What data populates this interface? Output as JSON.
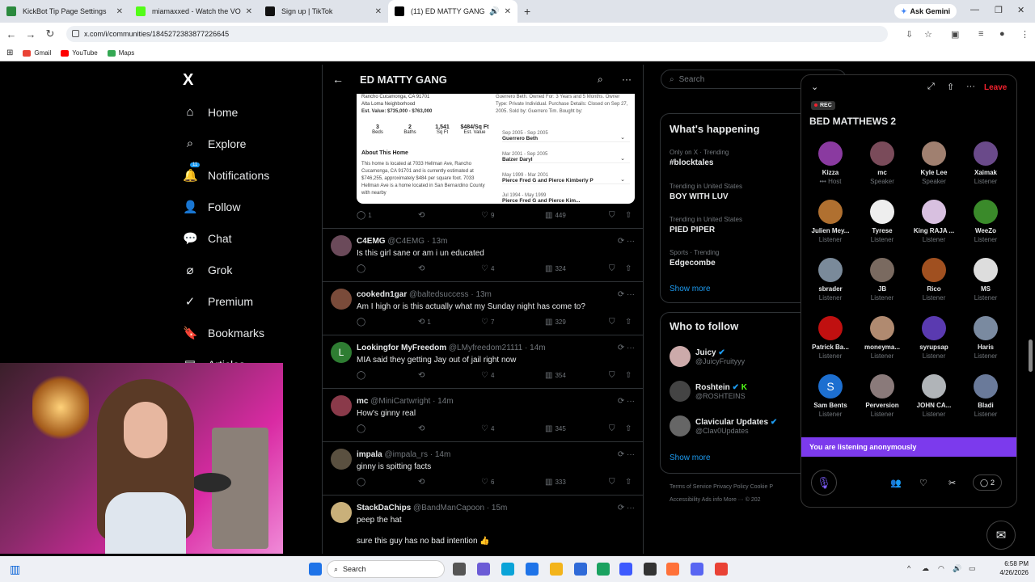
{
  "browser": {
    "tabs": [
      {
        "title": "KickBot Tip Page Settings",
        "color": "#2b8a3e"
      },
      {
        "title": "miamaxxed - Watch the VOD o",
        "color": "#53fc18"
      },
      {
        "title": "Sign up | TikTok",
        "color": "#111111"
      },
      {
        "title": "(11) ED MATTY GANG Com",
        "color": "#000000"
      }
    ],
    "new_tab": "+",
    "ask_gemini": "Ask Gemini",
    "url": "x.com/i/communities/1845272383877226645",
    "bookmarks": [
      "Gmail",
      "YouTube",
      "Maps"
    ]
  },
  "x_nav": {
    "logo": "X",
    "items": [
      {
        "label": "Home",
        "icon": "⌂"
      },
      {
        "label": "Explore",
        "icon": "⌕"
      },
      {
        "label": "Notifications",
        "icon": "🔔",
        "badge": "11"
      },
      {
        "label": "Follow",
        "icon": "👤"
      },
      {
        "label": "Chat",
        "icon": "💬"
      },
      {
        "label": "Grok",
        "icon": "⌀"
      },
      {
        "label": "Premium",
        "icon": "✓"
      },
      {
        "label": "Bookmarks",
        "icon": "🔖"
      },
      {
        "label": "Articles",
        "icon": "▤"
      }
    ]
  },
  "feed": {
    "title": "ED MATTY GANG",
    "listing": {
      "address": "Rancho Cucamonga, CA 91701",
      "neighborhood": "Alta Loma Neighborhood",
      "est_value": "Est. Value: $735,000 - $763,000",
      "stats": [
        {
          "v": "3",
          "l": "Beds"
        },
        {
          "v": "2",
          "l": "Baths"
        },
        {
          "v": "1,541",
          "l": "Sq Ft"
        },
        {
          "v": "$484/Sq Ft",
          "l": "Est. Value"
        }
      ],
      "about_title": "About This Home",
      "about_text": "This home is located at 7033 Hellman Ave, Rancho Cucamonga, CA 91701 and is currently estimated at $746,255, approximately $484 per square foot. 7033 Hellman Ave is a home located in San Bernardino County with nearby",
      "right_text": "Guerrero Beth. Owned For: 3 Years and 5 Months. Owner Type: Private Individual. Purchase Details: Closed on Sep 27, 2005. Sold by: Guerrero Tim. Bought by:",
      "history": [
        {
          "date": "Guerrero Beth",
          "name": ""
        },
        {
          "date": "Sep 2005 - Sep 2005",
          "name": "Guerrero Beth"
        },
        {
          "date": "Mar 2001 - Sep 2005",
          "name": "Balzer Daryl"
        },
        {
          "date": "May 1999 - Mar 2001",
          "name": "Pierce Fred G and Pierce Kimberly P"
        },
        {
          "date": "Jul 1994 - May 1999",
          "name": "Pierce Fred G and Pierce Kim..."
        }
      ],
      "actions": {
        "replies": "1",
        "likes": "9",
        "views": "449"
      }
    },
    "posts": [
      {
        "name": "C4EMG",
        "handle": "@C4EMG · 13m",
        "text": "Is this girl sane or am i un educated",
        "replies": "",
        "reposts": "",
        "likes": "4",
        "views": "324",
        "color": "#6b4a5a"
      },
      {
        "name": "cookedn1gar",
        "handle": "@baltedsuccess · 13m",
        "text": "Am I high or is this actually what my Sunday night has come to?",
        "replies": "",
        "reposts": "1",
        "likes": "7",
        "views": "329",
        "color": "#7a4b3a"
      },
      {
        "name": "Lookingfor MyFreedom",
        "handle": "@LMyfreedom21111 · 14m",
        "text": "MIA said they getting Jay out of jail right now",
        "replies": "",
        "reposts": "",
        "likes": "4",
        "views": "354",
        "color": "#2e7d32",
        "initial": "L"
      },
      {
        "name": "mc",
        "handle": "@MiniCartwright · 14m",
        "text": "How's ginny real",
        "replies": "",
        "reposts": "",
        "likes": "4",
        "views": "345",
        "color": "#8a3a4a"
      },
      {
        "name": "impala",
        "handle": "@impala_rs · 14m",
        "text": "ginny is spitting facts",
        "replies": "",
        "reposts": "",
        "likes": "6",
        "views": "333",
        "color": "#5a5040"
      },
      {
        "name": "StackDaChips",
        "handle": "@BandManCapoon · 15m",
        "text": "peep the hat",
        "text2": "sure this guy has no bad intention 👍",
        "color": "#c9b07a"
      }
    ]
  },
  "right": {
    "search_placeholder": "Search",
    "happening_title": "What's happening",
    "trends": [
      {
        "meta": "Only on X · Trending",
        "name": "#blocktales"
      },
      {
        "meta": "Trending in United States",
        "name": "BOY WITH LUV"
      },
      {
        "meta": "Trending in United States",
        "name": "PIED PIPER"
      },
      {
        "meta": "Sports · Trending",
        "name": "Edgecombe"
      }
    ],
    "show_more": "Show more",
    "who_title": "Who to follow",
    "follow": [
      {
        "name": "Juicy",
        "handle": "@JuicyFruityyy",
        "color": "#caa"
      },
      {
        "name": "Roshtein",
        "handle": "@ROSHTEINS",
        "color": "#444"
      },
      {
        "name": "Clavicular Updates",
        "handle": "@Clav0Updates",
        "color": "#666"
      }
    ],
    "footer1": "Terms of Service    Privacy Policy    Cookie P",
    "footer2": "Accessibility    Ads info    More ···    © 202"
  },
  "space": {
    "rec": "REC",
    "leave": "Leave",
    "title": "BED MATTHEWS 2",
    "people": [
      {
        "name": "Kizza",
        "role": "••• Host",
        "color": "#8a3aa0"
      },
      {
        "name": "mc",
        "role": "Speaker",
        "color": "#7a4b5a"
      },
      {
        "name": "Kyle Lee",
        "role": "Speaker",
        "color": "#a08070"
      },
      {
        "name": "Xaimak",
        "role": "Listener",
        "color": "#6a4a8a"
      },
      {
        "name": "Julien Mey...",
        "role": "Listener",
        "color": "#b07030"
      },
      {
        "name": "Tyrese",
        "role": "Listener",
        "color": "#eeeeee"
      },
      {
        "name": "King RAJA ...",
        "role": "Listener",
        "color": "#d8c0e0"
      },
      {
        "name": "WeeZo",
        "role": "Listener",
        "color": "#3a8a2a"
      },
      {
        "name": "sbrader",
        "role": "Listener",
        "color": "#7a8a9a"
      },
      {
        "name": "JB",
        "role": "Listener",
        "color": "#7a6a60"
      },
      {
        "name": "Rico",
        "role": "Listener",
        "color": "#a05020"
      },
      {
        "name": "MS",
        "role": "Listener",
        "color": "#dddddd"
      },
      {
        "name": "Patrick Ba...",
        "role": "Listener",
        "color": "#c01010"
      },
      {
        "name": "moneyma...",
        "role": "Listener",
        "color": "#b08a70"
      },
      {
        "name": "syrupsap",
        "role": "Listener",
        "color": "#5a3ab0"
      },
      {
        "name": "Haris",
        "role": "Listener",
        "color": "#7a8aa0"
      },
      {
        "name": "Sam Bents",
        "role": "Listener",
        "color": "#1d6fd0",
        "initial": "S"
      },
      {
        "name": "Perversion",
        "role": "Listener",
        "color": "#8a7a7a"
      },
      {
        "name": "JOHN CA...",
        "role": "Listener",
        "color": "#b0b4b8"
      },
      {
        "name": "Bladi",
        "role": "Listener",
        "color": "#6a7a9a"
      }
    ],
    "listening": "You are listening anonymously",
    "comments": "2"
  },
  "taskbar": {
    "search": "Search",
    "time": "6:58 PM",
    "date": "4/26/2026"
  }
}
